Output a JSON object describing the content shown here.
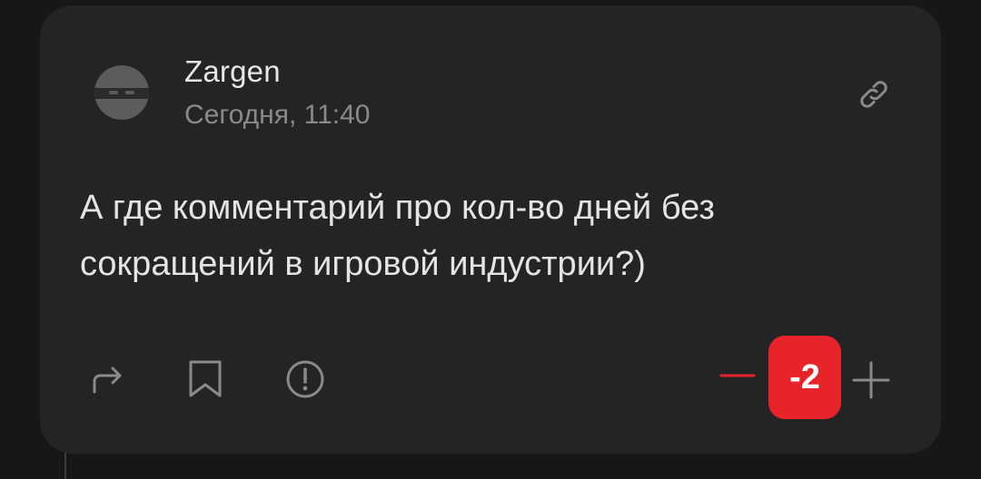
{
  "comment": {
    "author": "Zargen",
    "timestamp": "Сегодня, 11:40",
    "text": "А где комментарий про кол-во дней без сокращений в игровой индустрии?)",
    "rating": "-2"
  },
  "icons": {
    "link": "link-icon",
    "reply": "reply-arrow-icon",
    "bookmark": "bookmark-icon",
    "report": "report-icon",
    "downvote": "minus-icon",
    "upvote": "plus-icon"
  },
  "colors": {
    "background": "#171717",
    "card": "#242424",
    "text": "#e4e4e4",
    "muted": "#8a8a8a",
    "accent_negative": "#e8232a"
  }
}
